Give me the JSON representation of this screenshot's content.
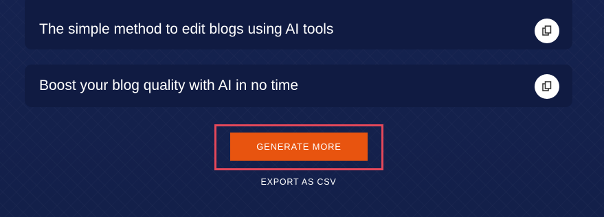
{
  "results": [
    {
      "text": "The simple method to edit blogs using AI tools",
      "copy_icon": "copy-icon"
    },
    {
      "text": "Boost your blog quality with AI in no time",
      "copy_icon": "copy-icon"
    }
  ],
  "actions": {
    "generate_label": "GENERATE MORE",
    "export_label": "EXPORT AS CSV"
  },
  "colors": {
    "background": "#14214d",
    "card": "#101b42",
    "accent": "#e8540f",
    "highlight": "#e5485a"
  }
}
